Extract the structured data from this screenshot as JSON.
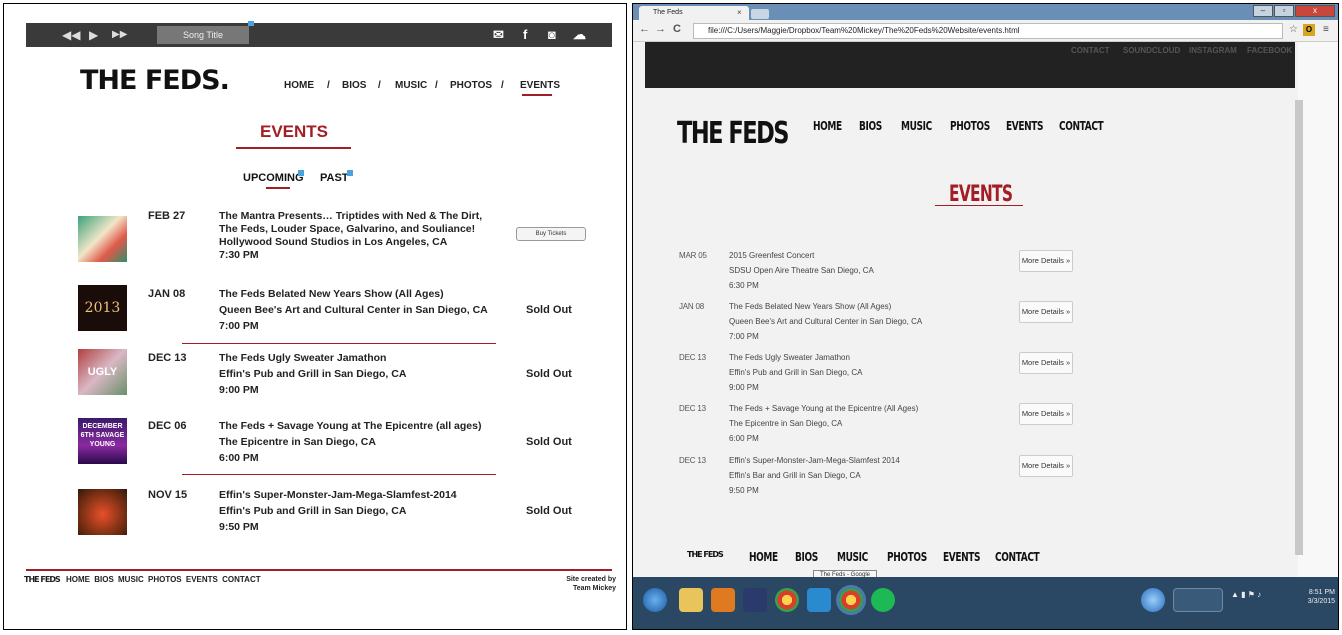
{
  "left": {
    "player": {
      "song_title": "Song Title",
      "prev": "◀◀",
      "play": "▶",
      "next": "▶▶"
    },
    "social": {
      "mail": "✉",
      "facebook": "f",
      "instagram": "◙",
      "soundcloud": "☁"
    },
    "logo": "THE FEDS.",
    "nav": [
      "HOME",
      "BIOS",
      "MUSIC",
      "PHOTOS",
      "EVENTS"
    ],
    "nav_sep": "/",
    "page_title": "EVENTS",
    "tabs": [
      "UPCOMING",
      "PAST"
    ],
    "events": [
      {
        "date": "FEB 27",
        "lines": [
          "The Mantra Presents… Triptides with Ned & The Dirt,",
          "The Feds, Louder Space, Galvarino, and Souliance!",
          "Hollywood Sound Studios in Los Angeles, CA",
          "7:30 PM"
        ],
        "action": "Buy Tickets"
      },
      {
        "date": "JAN 08",
        "lines": [
          "The Feds Belated New Years Show (All Ages)",
          "Queen Bee's Art and Cultural Center in San Diego, CA",
          "7:00 PM"
        ],
        "action": "Sold Out"
      },
      {
        "date": "DEC 13",
        "lines": [
          "The Feds Ugly Sweater Jamathon",
          "Effin's Pub and Grill in San Diego, CA",
          "9:00 PM"
        ],
        "action": "Sold Out"
      },
      {
        "date": "DEC 06",
        "lines": [
          "The Feds + Savage Young at The Epicentre (all ages)",
          "The Epicentre in San Diego, CA",
          "6:00 PM"
        ],
        "action": "Sold Out"
      },
      {
        "date": "NOV 15",
        "lines": [
          "Effin's Super-Monster-Jam-Mega-Slamfest-2014",
          "Effin's Pub and Grill in San Diego, CA",
          "9:50 PM"
        ],
        "action": "Sold Out"
      }
    ],
    "thumb_text": {
      "t2": "2013",
      "t3": "UGLY",
      "t4": "DECEMBER 6TH SAVAGE YOUNG"
    },
    "footer": {
      "logo": "THE FEDS",
      "links": "HOME  BIOS  MUSIC  PHOTOS  EVENTS  CONTACT",
      "credit_1": "Site created by",
      "credit_2": "Team Mickey"
    }
  },
  "right": {
    "tab_title": "The Feds",
    "tab_close": "×",
    "url": "file:///C:/Users/Maggie/Dropbox/Team%20Mickey/The%20Feds%20Website/events.html",
    "win_min": "–",
    "win_max": "▫",
    "win_close": "x",
    "back": "←",
    "forward": "→",
    "reload": "C",
    "star": "☆",
    "ext": "O",
    "menu": "≡",
    "topbar_links": [
      "CONTACT",
      "SOUNDCLOUD",
      "INSTAGRAM",
      "FACEBOOK"
    ],
    "logo": "THE FEDS",
    "nav": [
      "HOME",
      "BIOS",
      "MUSIC",
      "PHOTOS",
      "EVENTS",
      "CONTACT"
    ],
    "page_title": "EVENTS",
    "events": [
      {
        "date": "MAR 05",
        "lines": [
          "2015 Greenfest Concert",
          "SDSU Open Aire Theatre San Diego, CA",
          "6:30 PM"
        ]
      },
      {
        "date": "JAN 08",
        "lines": [
          "The Feds Belated New Years Show (All Ages)",
          "Queen Bee's Art and Cultural Center in San Diego, CA",
          "7:00 PM"
        ]
      },
      {
        "date": "DEC 13",
        "lines": [
          "The Feds Ugly Sweater Jamathon",
          "Effin's Pub and Grill in San Diego, CA",
          "9:00 PM"
        ]
      },
      {
        "date": "DEC 13",
        "lines": [
          "The Feds + Savage Young at the Epicentre (All Ages)",
          "The Epicentre in San Diego, CA",
          "6:00 PM"
        ]
      },
      {
        "date": "DEC 13",
        "lines": [
          "Effin's Super-Monster-Jam-Mega-Slamfest 2014",
          "Effin's Bar and Grill in San Diego, CA",
          "9:50 PM"
        ]
      }
    ],
    "more_label": "More Details »",
    "footer": {
      "logo": "THE FEDS",
      "nav": [
        "HOME",
        "BIOS",
        "MUSIC",
        "PHOTOS",
        "EVENTS",
        "CONTACT"
      ]
    },
    "tooltip": "The Feds - Google Chrome",
    "clock": {
      "time": "8:51 PM",
      "date": "3/3/2015"
    },
    "tray": "▲ ▮ ⚑ ♪",
    "colors": {
      "accent": "#a31d24",
      "taskbar": "#2a4763"
    }
  }
}
